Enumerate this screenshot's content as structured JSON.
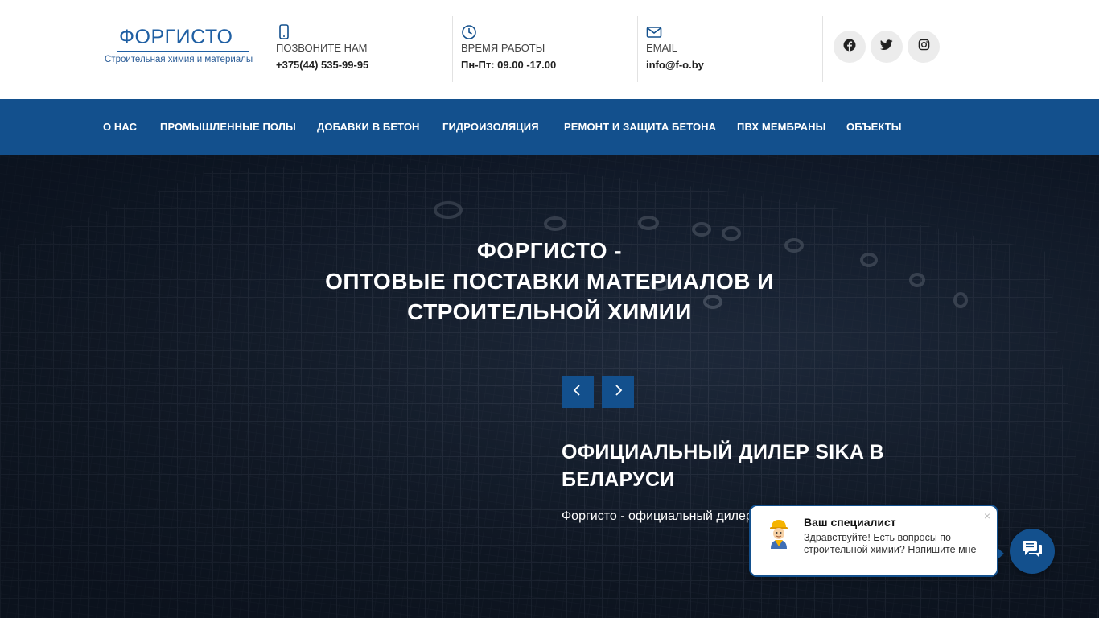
{
  "header": {
    "logo": {
      "name": "ФОРГИСТО",
      "tagline": "Строительная химия и материалы"
    },
    "contacts": [
      {
        "icon": "mobile-phone-icon",
        "label": "ПОЗВОНИТЕ НАМ",
        "value": "+375(44) 535-99-95"
      },
      {
        "icon": "clock-icon",
        "label": "ВРЕМЯ РАБОТЫ",
        "value": "Пн-Пт: 09.00 -17.00"
      },
      {
        "icon": "envelope-icon",
        "label": "EMAIL",
        "value": "info@f-o.by"
      }
    ],
    "social": [
      "facebook-icon",
      "twitter-icon",
      "instagram-icon"
    ]
  },
  "nav": {
    "items": [
      "О НАС",
      "ПРОМЫШЛЕННЫЕ ПОЛЫ",
      "ДОБАВКИ В БЕТОН",
      "ГИДРОИЗОЛЯЦИЯ",
      "РЕМОНТ И ЗАЩИТА БЕТОНА",
      "ПВХ МЕМБРАНЫ",
      "ОБЪЕКТЫ"
    ]
  },
  "hero": {
    "title_lines": [
      "ФОРГИСТО -",
      "ОПТОВЫЕ ПОСТАВКИ МАТЕРИАЛОВ И",
      "СТРОИТЕЛЬНОЙ ХИМИИ"
    ],
    "slide_title": "ОФИЦИАЛЬНЫЙ ДИЛЕР SIKA В БЕЛАРУСИ",
    "slide_text": "Форгисто - официальный дилер"
  },
  "chat": {
    "name": "Ваш специалист",
    "message": "Здравствуйте! Есть вопросы по строительной химии? Напишите мне",
    "close": "×"
  },
  "colors": {
    "brand": "#13508d",
    "logo": "#1f5fa3"
  }
}
